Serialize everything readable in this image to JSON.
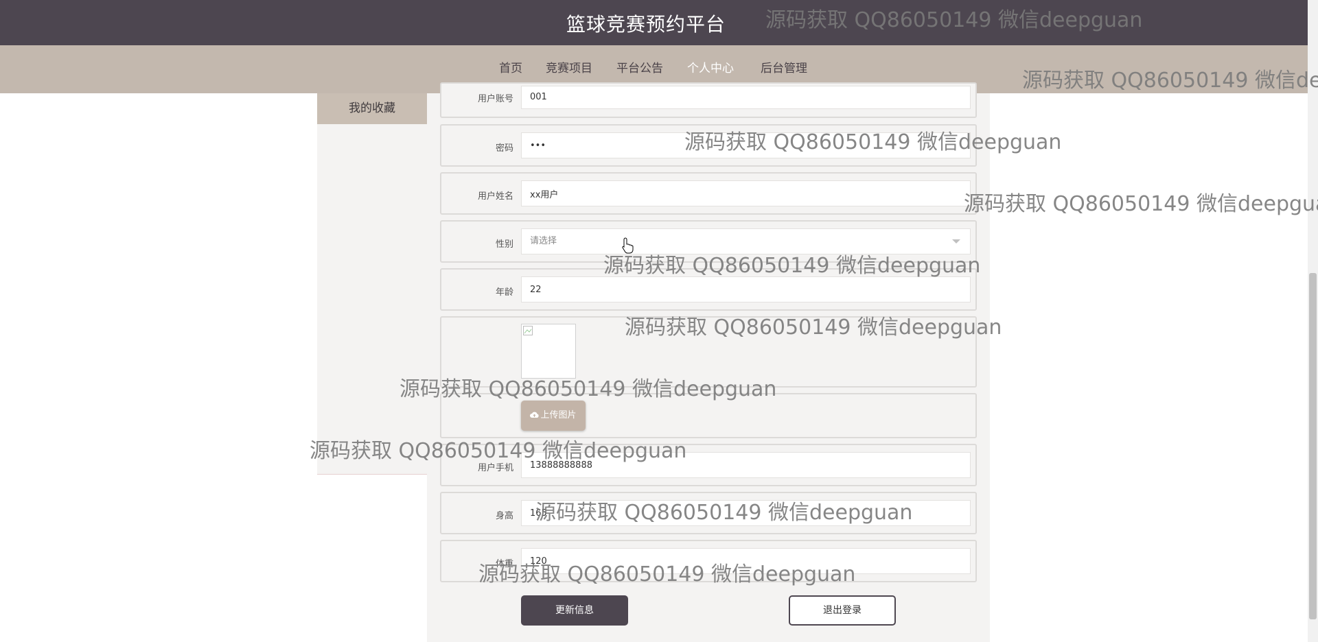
{
  "site": {
    "title": "篮球竞赛预约平台"
  },
  "nav": {
    "items": [
      {
        "label": "首页",
        "active": false
      },
      {
        "label": "竞赛项目",
        "active": false
      },
      {
        "label": "平台公告",
        "active": false
      },
      {
        "label": "个人中心",
        "active": true
      },
      {
        "label": "后台管理",
        "active": false
      }
    ]
  },
  "sidebar": {
    "favorites_label": "我的收藏"
  },
  "form": {
    "account": {
      "label": "用户账号",
      "value": "001"
    },
    "password": {
      "label": "密码",
      "value": "•••"
    },
    "name": {
      "label": "用户姓名",
      "value": "xx用户"
    },
    "gender": {
      "label": "性别",
      "placeholder": "请选择"
    },
    "age": {
      "label": "年龄",
      "value": "22"
    },
    "upload_label": "上传图片",
    "phone": {
      "label": "用户手机",
      "value": "13888888888"
    },
    "height": {
      "label": "身高",
      "value": "165"
    },
    "weight": {
      "label": "体重",
      "value": "120"
    }
  },
  "buttons": {
    "update": "更新信息",
    "logout": "退出登录"
  },
  "watermark": "源码获取 QQ86050149 微信deepguan",
  "colors": {
    "header": "#4d4650",
    "nav": "#c3b8ae",
    "accent": "#c9beb3"
  }
}
